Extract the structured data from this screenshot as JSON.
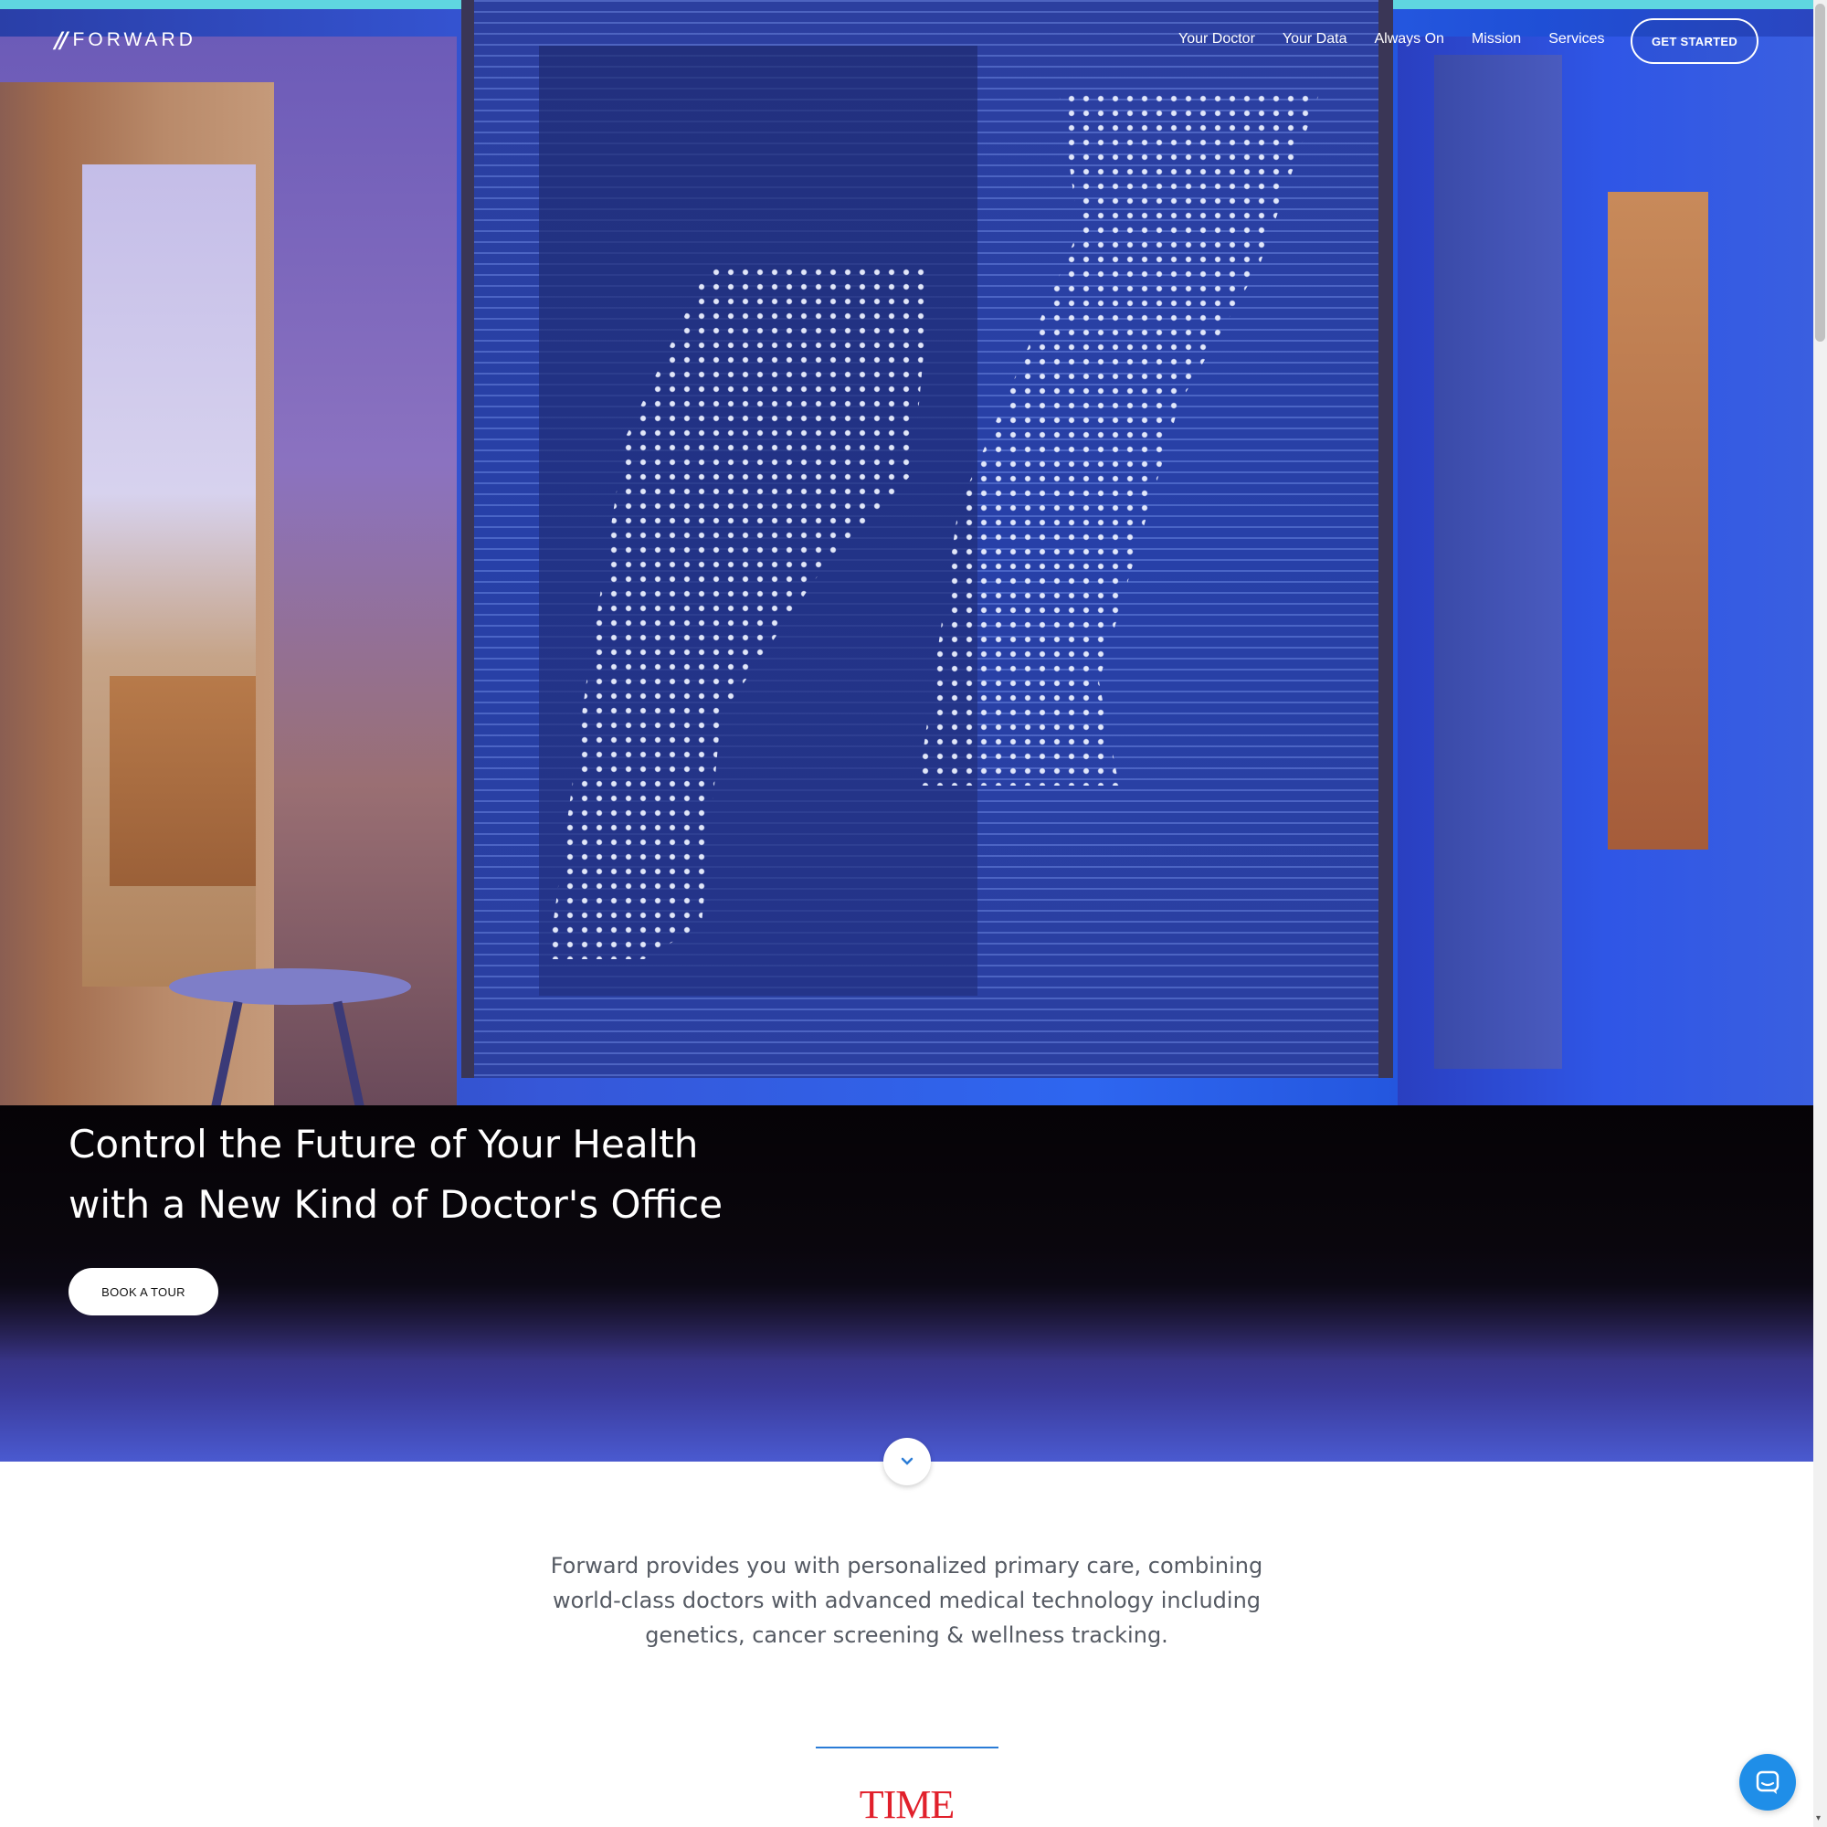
{
  "brand": {
    "logo_mark": "//",
    "logo_text": "FORWARD"
  },
  "nav": {
    "items": [
      "Your Doctor",
      "Your Data",
      "Always On",
      "Mission",
      "Services"
    ],
    "cta": "GET STARTED"
  },
  "hero": {
    "headline_line1": "Control the Future of Your Health",
    "headline_line2": "with a New Kind of Doctor's Office",
    "button": "BOOK A TOUR",
    "scroll_icon": "chevron-down-icon"
  },
  "intro": {
    "text": "Forward provides you with personalized primary care, combining world-class doctors with advanced medical technology including genetics, cancer screening & wellness tracking."
  },
  "press": {
    "logo": "TIME"
  },
  "colors": {
    "accent": "#2b7cd6",
    "press_red": "#e1202b",
    "chat": "#1f8ee8"
  },
  "chat": {
    "icon": "chat-bubble-icon"
  }
}
